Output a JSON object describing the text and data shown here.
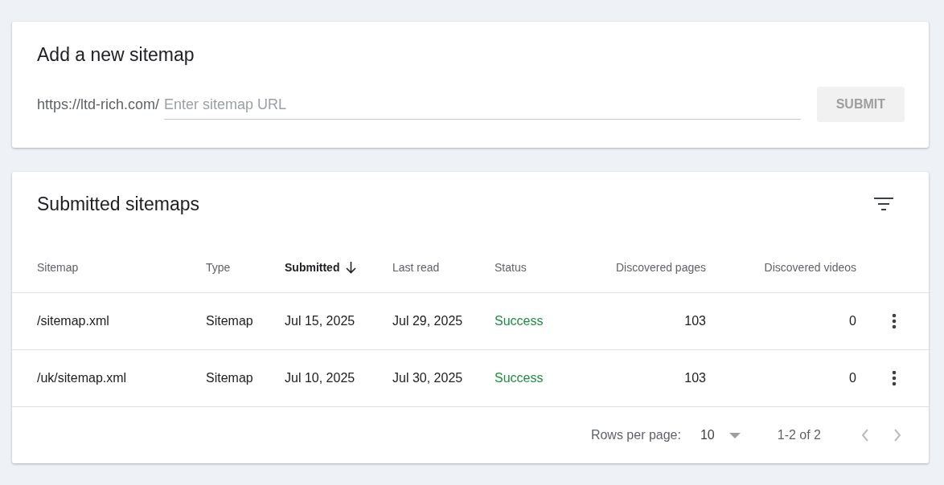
{
  "add_card": {
    "title": "Add a new sitemap",
    "url_prefix": "https://ltd-rich.com/",
    "url_field": {
      "placeholder": "Enter sitemap URL"
    },
    "submit": {
      "label": "SUBMIT",
      "disabled": true
    }
  },
  "submitted_card": {
    "title": "Submitted sitemaps",
    "columns": [
      {
        "label": "Sitemap",
        "kind": "text",
        "sorted": false
      },
      {
        "label": "Type",
        "kind": "text",
        "sorted": false
      },
      {
        "label": "Submitted",
        "kind": "text",
        "sorted": true
      },
      {
        "label": "Last read",
        "kind": "text",
        "sorted": false
      },
      {
        "label": "Status",
        "kind": "status",
        "sorted": false
      },
      {
        "label": "Discovered pages",
        "kind": "numeric",
        "sorted": false
      },
      {
        "label": "Discovered videos",
        "kind": "numeric",
        "sorted": false
      }
    ],
    "rows": [
      {
        "cells": [
          "/sitemap.xml",
          "Sitemap",
          "Jul 15, 2025",
          "Jul 29, 2025",
          "Success",
          "103",
          "0"
        ]
      },
      {
        "cells": [
          "/uk/sitemap.xml",
          "Sitemap",
          "Jul 10, 2025",
          "Jul 30, 2025",
          "Success",
          "103",
          "0"
        ]
      }
    ],
    "pagination": {
      "rows_per_page_label": "Rows per page:",
      "rows_per_page": "10",
      "range": "1-2 of 2",
      "prev_disabled": true,
      "next_disabled": true
    }
  }
}
